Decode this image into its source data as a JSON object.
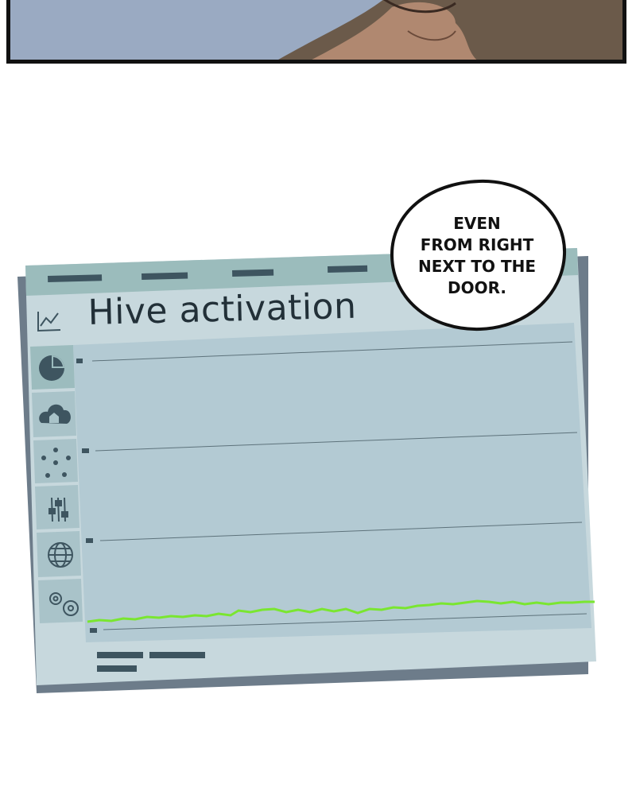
{
  "title": "Hive activation",
  "speech_bubble": {
    "lines": [
      "EVEN",
      "FROM RIGHT",
      "NEXT TO THE",
      "DOOR."
    ]
  },
  "sidebar_icons": [
    "chart-line-icon",
    "pie-chart-icon",
    "cloud-home-icon",
    "dots-icon",
    "sliders-icon",
    "globe-icon",
    "gears-icon"
  ],
  "colors": {
    "screen": "#b4cbd3",
    "header_band": "#9bbcbc",
    "line": "#7ae630",
    "frame": "#5f6f7d"
  }
}
